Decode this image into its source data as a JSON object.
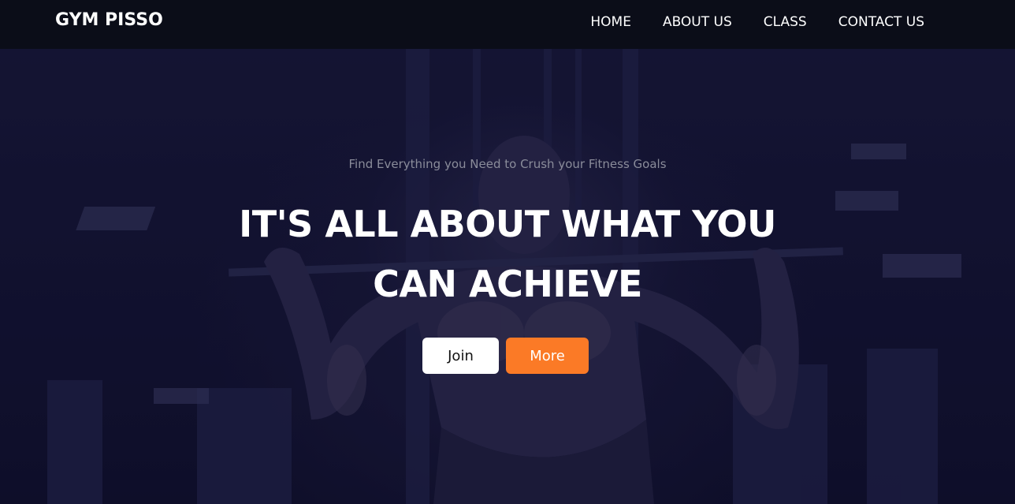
{
  "navbar": {
    "brand": "GYM PISSO",
    "links": [
      {
        "label": "HOME"
      },
      {
        "label": "ABOUT US"
      },
      {
        "label": "CLASS"
      },
      {
        "label": "CONTACT US"
      }
    ]
  },
  "hero": {
    "tagline": "Find Everything you Need to Crush your Fitness Goals",
    "headline_line1": "IT'S ALL ABOUT WHAT YOU",
    "headline_line2": "CAN ACHIEVE",
    "background_image": "gym-workout-photo",
    "buttons": {
      "join_label": "Join",
      "more_label": "More"
    }
  },
  "colors": {
    "navbar_bg": "#0b0d18",
    "hero_overlay": "#121230",
    "accent": "#fb7a26",
    "text_primary": "#ffffff",
    "text_muted": "#8a8c9a"
  }
}
